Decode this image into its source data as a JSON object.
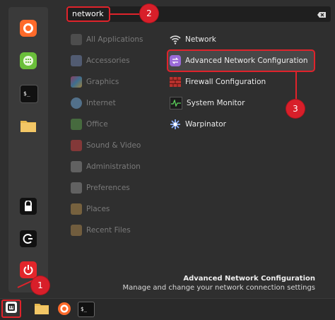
{
  "search": {
    "value": "network"
  },
  "favorites": [
    {
      "icon": "firefox-icon"
    },
    {
      "icon": "calculator-icon"
    },
    {
      "icon": "terminal-icon"
    },
    {
      "icon": "folder-icon"
    },
    {
      "icon": "lock-icon"
    },
    {
      "icon": "logout-icon"
    },
    {
      "icon": "power-icon"
    }
  ],
  "categories": [
    {
      "label": "All Applications",
      "icon": "grid-icon"
    },
    {
      "label": "Accessories",
      "icon": "tools-icon"
    },
    {
      "label": "Graphics",
      "icon": "palette-icon"
    },
    {
      "label": "Internet",
      "icon": "cloud-icon"
    },
    {
      "label": "Office",
      "icon": "office-icon"
    },
    {
      "label": "Sound & Video",
      "icon": "play-icon"
    },
    {
      "label": "Administration",
      "icon": "admin-icon"
    },
    {
      "label": "Preferences",
      "icon": "preferences-icon"
    },
    {
      "label": "Places",
      "icon": "folder-icon"
    },
    {
      "label": "Recent Files",
      "icon": "recent-files-icon"
    }
  ],
  "results": [
    {
      "label": "Network",
      "icon": "wifi-icon"
    },
    {
      "label": "Advanced Network Configuration",
      "icon": "network-config-icon"
    },
    {
      "label": "Firewall Configuration",
      "icon": "firewall-icon"
    },
    {
      "label": "System Monitor",
      "icon": "system-monitor-icon"
    },
    {
      "label": "Warpinator",
      "icon": "warpinator-icon"
    }
  ],
  "description": {
    "title": "Advanced Network Configuration",
    "body": "Manage and change your network connection settings"
  },
  "badges": [
    "1",
    "2",
    "3"
  ],
  "taskbar": [
    {
      "icon": "menu-icon"
    },
    {
      "icon": "folder-icon"
    },
    {
      "icon": "firefox-icon"
    },
    {
      "icon": "terminal-icon"
    }
  ],
  "colors": {
    "accent_red": "#e0232b",
    "badge_red": "#d81f2a",
    "menu_bg": "#2f2f2f"
  }
}
